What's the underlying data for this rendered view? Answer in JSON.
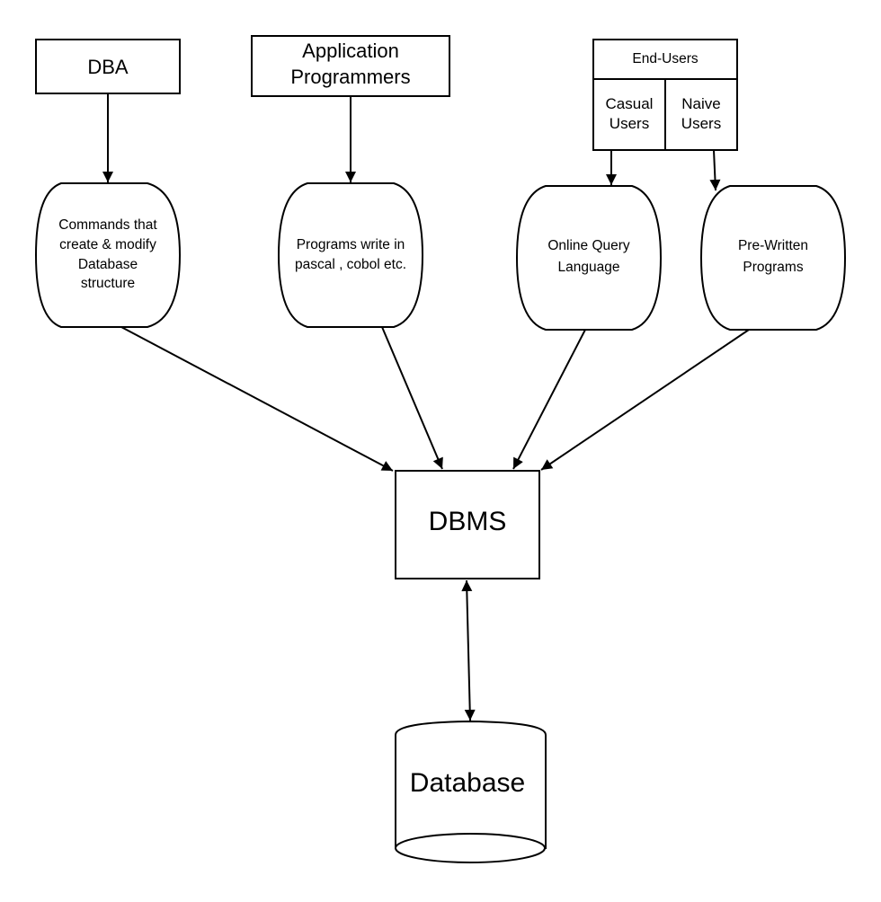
{
  "diagram": {
    "nodes": {
      "dba": {
        "label": "DBA"
      },
      "app_programmers": {
        "lines": [
          "Application",
          "Programmers"
        ]
      },
      "end_users": {
        "title": "End-Users",
        "casual": {
          "lines": [
            "Casual",
            "Users"
          ]
        },
        "naive": {
          "lines": [
            "Naive",
            "Users"
          ]
        }
      },
      "commands": {
        "lines": [
          "Commands that",
          "create & modify",
          "Database",
          "structure"
        ]
      },
      "programs": {
        "lines": [
          "Programs write in",
          "pascal , cobol etc."
        ]
      },
      "online_query": {
        "lines": [
          "Online Query",
          "Language"
        ]
      },
      "prewritten": {
        "lines": [
          "Pre-Written",
          "Programs"
        ]
      },
      "dbms": {
        "label": "DBMS"
      },
      "database": {
        "label": "Database"
      }
    },
    "edges": [
      {
        "from": "DBA",
        "to": "Commands that create & modify Database structure",
        "direction": "forward"
      },
      {
        "from": "Application Programmers",
        "to": "Programs write in pascal , cobol etc.",
        "direction": "forward"
      },
      {
        "from": "Casual Users",
        "to": "Online Query Language",
        "direction": "forward"
      },
      {
        "from": "Naive Users",
        "to": "Pre-Written Programs",
        "direction": "forward"
      },
      {
        "from": "Commands that create & modify Database structure",
        "to": "DBMS",
        "direction": "forward"
      },
      {
        "from": "Programs write in pascal , cobol etc.",
        "to": "DBMS",
        "direction": "forward"
      },
      {
        "from": "Online Query Language",
        "to": "DBMS",
        "direction": "forward"
      },
      {
        "from": "Pre-Written Programs",
        "to": "DBMS",
        "direction": "forward"
      },
      {
        "from": "DBMS",
        "to": "Database",
        "direction": "bidirectional"
      }
    ]
  }
}
